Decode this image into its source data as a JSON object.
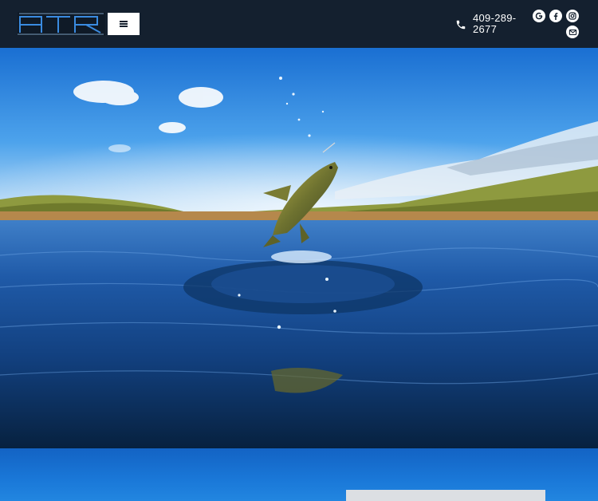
{
  "header": {
    "logo_text": "ATR",
    "menu_icon": "hamburger-menu-icon",
    "phone": {
      "icon": "phone-icon",
      "number": "409-289-2677"
    },
    "social": [
      {
        "name": "google",
        "icon": "google-icon"
      },
      {
        "name": "facebook",
        "icon": "facebook-icon"
      },
      {
        "name": "instagram",
        "icon": "instagram-icon"
      },
      {
        "name": "email",
        "icon": "envelope-icon"
      }
    ]
  },
  "hero": {
    "image": "largemouth-bass-jumping-from-lake"
  },
  "colors": {
    "header_bg": "#14202f",
    "logo_blue": "#2f7fd6",
    "sky_top": "#1e74d6",
    "water_deep": "#0a2f5c"
  }
}
